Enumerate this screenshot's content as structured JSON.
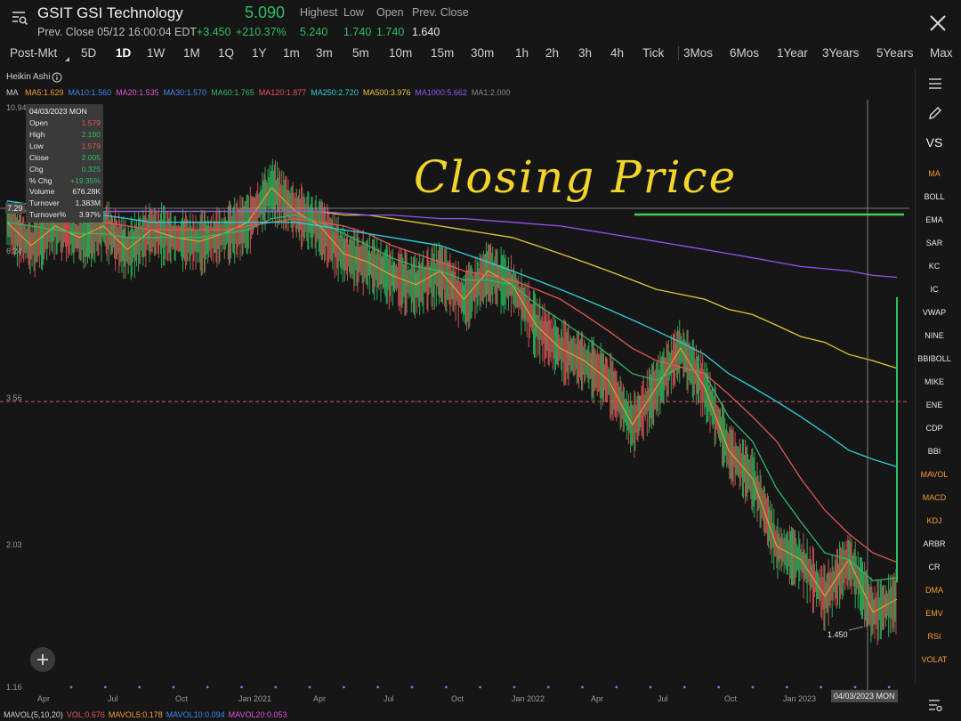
{
  "header": {
    "title": "GSIT GSI Technology",
    "last_price": "5.090",
    "prev_close_text": "Prev. Close 05/12 16:00:04 EDT",
    "change_abs": "+3.450",
    "change_pct": "+210.37%",
    "quote_labels": [
      "Highest",
      "Low",
      "Open",
      "Prev. Close"
    ],
    "quote_values": [
      "5.240",
      "1.740",
      "1.740",
      "1.640"
    ]
  },
  "timeframes": [
    "Post-Mkt",
    "5D",
    "1D",
    "1W",
    "1M",
    "1Q",
    "1Y",
    "1m",
    "3m",
    "5m",
    "10m",
    "15m",
    "30m",
    "1h",
    "2h",
    "3h",
    "4h",
    "Tick",
    "3Mos",
    "6Mos",
    "1Year",
    "3Years",
    "5Years",
    "Max"
  ],
  "active_timeframe": "1D",
  "chart_type_label": "Heikin Ashi",
  "ma_label": "MA",
  "ma_items": [
    {
      "text": "MA5:1.629",
      "color": "#f39c34"
    },
    {
      "text": "MA10:1.560",
      "color": "#3f86f0"
    },
    {
      "text": "MA20:1.535",
      "color": "#e052d8"
    },
    {
      "text": "MA30:1.570",
      "color": "#3f86f0"
    },
    {
      "text": "MA60:1.765",
      "color": "#2fb86a"
    },
    {
      "text": "MA120:1.877",
      "color": "#e25757"
    },
    {
      "text": "MA250:2.720",
      "color": "#2ecfd8"
    },
    {
      "text": "MA500:3.976",
      "color": "#e8c53a"
    },
    {
      "text": "MA1000:5.662",
      "color": "#9055f0"
    },
    {
      "text": "MA1:2.000",
      "color": "#888888"
    }
  ],
  "tooltip": {
    "date": "04/03/2023 MON",
    "rows": [
      {
        "k": "Open",
        "v": "1.579",
        "color": "#e25757"
      },
      {
        "k": "High",
        "v": "2.190",
        "color": "#2fbf60"
      },
      {
        "k": "Low",
        "v": "1.579",
        "color": "#e25757"
      },
      {
        "k": "Close",
        "v": "2.005",
        "color": "#2fbf60"
      },
      {
        "k": "Chg",
        "v": "0.325",
        "color": "#2fbf60"
      },
      {
        "k": "% Chg",
        "v": "+19.35%",
        "color": "#2fbf60"
      },
      {
        "k": "Volume",
        "v": "676.28K",
        "color": "#e8e8e8"
      },
      {
        "k": "Turnover",
        "v": "1.383M",
        "color": "#e8e8e8"
      },
      {
        "k": "Turnover%",
        "v": "3.97%",
        "color": "#e8e8e8"
      }
    ]
  },
  "cursor_price": "7.29",
  "cursor_date": "04/03/2023 MON",
  "low_marker": "1.450",
  "annotation_text": "Closing Price",
  "mavol_items": [
    {
      "text": "MAVOL(5,10,20)",
      "color": "#cfcfcf"
    },
    {
      "text": "VOL:0.676",
      "color": "#e25757"
    },
    {
      "text": "MAVOL5:0.178",
      "color": "#f39c34"
    },
    {
      "text": "MAVOL10:0.094",
      "color": "#3f86f0"
    },
    {
      "text": "MAVOL20:0.053",
      "color": "#e052d8"
    }
  ],
  "indicators": [
    {
      "label": "MA",
      "color": "#f39c34"
    },
    {
      "label": "BOLL",
      "color": "#e8e8e8"
    },
    {
      "label": "EMA",
      "color": "#e8e8e8"
    },
    {
      "label": "SAR",
      "color": "#e8e8e8"
    },
    {
      "label": "KC",
      "color": "#e8e8e8"
    },
    {
      "label": "IC",
      "color": "#e8e8e8"
    },
    {
      "label": "VWAP",
      "color": "#e8e8e8"
    },
    {
      "label": "NINE",
      "color": "#e8e8e8"
    },
    {
      "label": "BBIBOLL",
      "color": "#e8e8e8"
    },
    {
      "label": "MIKE",
      "color": "#e8e8e8"
    },
    {
      "label": "ENE",
      "color": "#e8e8e8"
    },
    {
      "label": "CDP",
      "color": "#e8e8e8"
    },
    {
      "label": "BBI",
      "color": "#e8e8e8"
    },
    {
      "label": "MAVOL",
      "color": "#f39c34"
    },
    {
      "label": "MACD",
      "color": "#f39c34"
    },
    {
      "label": "KDJ",
      "color": "#f39c34"
    },
    {
      "label": "ARBR",
      "color": "#e8e8e8"
    },
    {
      "label": "CR",
      "color": "#e8e8e8"
    },
    {
      "label": "DMA",
      "color": "#f39c34"
    },
    {
      "label": "EMV",
      "color": "#f39c34"
    },
    {
      "label": "RSI",
      "color": "#f39c34"
    },
    {
      "label": "VOLAT",
      "color": "#f39c34"
    }
  ],
  "vs_label": "VS",
  "chart_data": {
    "type": "line",
    "scale": "log",
    "y_ticks": [
      "10.94",
      "6.24",
      "3.56",
      "2.03",
      "1.16"
    ],
    "ylim": [
      1.16,
      10.94
    ],
    "x_ticks": [
      "Apr",
      "Jul",
      "Oct",
      "Jan 2021",
      "Apr",
      "Jul",
      "Oct",
      "Jan 2022",
      "Apr",
      "Jul",
      "Oct",
      "Jan 2023"
    ],
    "x": [
      "2020-03",
      "2020-04",
      "2020-05",
      "2020-06",
      "2020-07",
      "2020-08",
      "2020-09",
      "2020-10",
      "2020-11",
      "2020-12",
      "2021-01",
      "2021-02",
      "2021-03",
      "2021-04",
      "2021-05",
      "2021-06",
      "2021-07",
      "2021-08",
      "2021-09",
      "2021-10",
      "2021-11",
      "2021-12",
      "2022-01",
      "2022-02",
      "2022-03",
      "2022-04",
      "2022-05",
      "2022-06",
      "2022-07",
      "2022-08",
      "2022-09",
      "2022-10",
      "2022-11",
      "2022-12",
      "2023-01",
      "2023-02",
      "2023-03",
      "2023-04"
    ],
    "series": [
      {
        "name": "MA5",
        "color": "#f39c34",
        "values": [
          7.0,
          6.4,
          6.9,
          6.6,
          6.9,
          6.3,
          6.8,
          6.6,
          6.5,
          6.7,
          7.0,
          8.0,
          7.3,
          6.9,
          6.2,
          6.0,
          5.7,
          5.5,
          5.8,
          5.2,
          5.8,
          5.5,
          4.7,
          4.3,
          4.1,
          3.8,
          3.2,
          3.7,
          4.3,
          3.7,
          2.9,
          2.6,
          2.0,
          1.9,
          1.65,
          1.9,
          1.55,
          1.63
        ]
      },
      {
        "name": "MA60",
        "color": "#2fb86a",
        "values": [
          7.0,
          6.9,
          6.8,
          6.7,
          6.7,
          6.6,
          6.6,
          6.6,
          6.6,
          6.7,
          6.8,
          7.1,
          7.2,
          7.0,
          6.7,
          6.4,
          6.1,
          5.9,
          5.8,
          5.6,
          5.6,
          5.5,
          5.1,
          4.8,
          4.5,
          4.2,
          3.9,
          3.8,
          4.0,
          3.9,
          3.3,
          3.0,
          2.5,
          2.2,
          1.95,
          1.9,
          1.75,
          1.77
        ]
      },
      {
        "name": "MA120",
        "color": "#e25757",
        "values": [
          7.4,
          7.3,
          7.2,
          7.1,
          7.0,
          6.9,
          6.8,
          6.8,
          6.8,
          6.8,
          6.9,
          7.0,
          7.1,
          7.0,
          6.9,
          6.7,
          6.4,
          6.2,
          6.0,
          5.8,
          5.7,
          5.6,
          5.4,
          5.2,
          4.9,
          4.6,
          4.3,
          4.1,
          4.0,
          3.9,
          3.6,
          3.3,
          3.0,
          2.6,
          2.3,
          2.1,
          1.95,
          1.88
        ]
      },
      {
        "name": "MA250",
        "color": "#2ecfd8",
        "values": [
          7.6,
          7.5,
          7.4,
          7.3,
          7.2,
          7.1,
          7.0,
          7.0,
          7.0,
          7.0,
          7.0,
          7.0,
          7.0,
          6.9,
          6.8,
          6.7,
          6.6,
          6.5,
          6.4,
          6.2,
          6.0,
          5.8,
          5.6,
          5.4,
          5.2,
          5.0,
          4.8,
          4.6,
          4.4,
          4.2,
          3.9,
          3.7,
          3.5,
          3.3,
          3.1,
          2.9,
          2.8,
          2.72
        ]
      },
      {
        "name": "MA500",
        "color": "#e8c53a",
        "values": [
          7.3,
          7.3,
          7.3,
          7.3,
          7.3,
          7.3,
          7.3,
          7.3,
          7.3,
          7.3,
          7.3,
          7.3,
          7.3,
          7.3,
          7.2,
          7.2,
          7.1,
          7.0,
          6.9,
          6.8,
          6.7,
          6.6,
          6.4,
          6.2,
          6.0,
          5.8,
          5.6,
          5.4,
          5.3,
          5.2,
          5.0,
          4.9,
          4.7,
          4.5,
          4.4,
          4.2,
          4.1,
          3.98
        ]
      },
      {
        "name": "MA1000",
        "color": "#9055f0",
        "values": [
          7.3,
          7.3,
          7.3,
          7.3,
          7.3,
          7.3,
          7.3,
          7.3,
          7.3,
          7.3,
          7.3,
          7.3,
          7.3,
          7.3,
          7.25,
          7.2,
          7.2,
          7.15,
          7.1,
          7.1,
          7.05,
          7.0,
          6.95,
          6.9,
          6.8,
          6.7,
          6.6,
          6.5,
          6.4,
          6.3,
          6.2,
          6.1,
          6.0,
          5.9,
          5.85,
          5.8,
          5.7,
          5.66
        ]
      }
    ],
    "last_points": [
      {
        "name": "spike",
        "x": "2023-05",
        "values": [
          1.74,
          5.24
        ]
      }
    ],
    "prev_close_line": 3.5,
    "legend_position": "top-left"
  }
}
